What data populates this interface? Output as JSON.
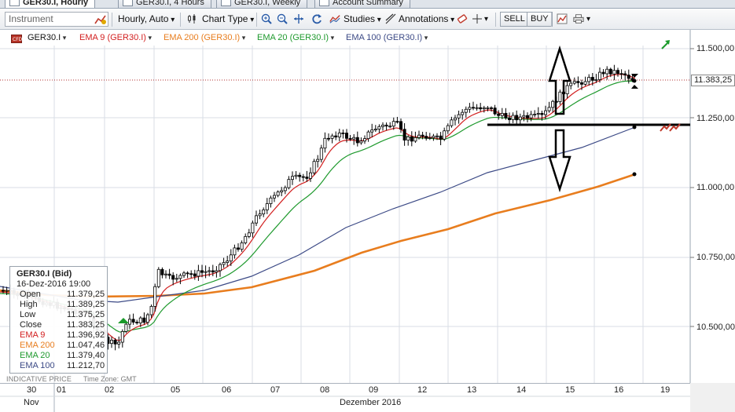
{
  "tabs": [
    {
      "label": "GER30.I, Hourly",
      "active": true
    },
    {
      "label": "GER30.I, 4 Hours",
      "active": false
    },
    {
      "label": "GER30.I, Weekly",
      "active": false
    },
    {
      "label": "Account Summary",
      "active": false
    }
  ],
  "toolbar": {
    "instrument_placeholder": "Instrument",
    "interval": "Hourly, Auto",
    "chart_type": "Chart Type",
    "studies": "Studies",
    "annotations": "Annotations",
    "sell": "SELL",
    "buy": "BUY"
  },
  "legend": {
    "symbol": "GER30.I",
    "ema9": "EMA 9 (GER30.I)",
    "ema200": "EMA 200 (GER30.I)",
    "ema20": "EMA 20 (GER30.I)",
    "ema100": "EMA 100 (GER30.I)"
  },
  "colors": {
    "ema9": "#d21f1f",
    "ema200": "#e87d1e",
    "ema20": "#1f9a2e",
    "ema100": "#3c4a86",
    "candle": "#000000",
    "grid": "#d9dee5",
    "price_line": "#b03030"
  },
  "y_axis": {
    "labels": [
      "11.500,00",
      "11.250,00",
      "11.000,00",
      "10.750,00",
      "10.500,00"
    ],
    "current_price": "11.383,25"
  },
  "info_box": {
    "title": "GER30.I (Bid)",
    "date": "16-Dez-2016 19:00",
    "rows": [
      {
        "key": "Open",
        "value": "11.379,25",
        "color": "#000000"
      },
      {
        "key": "High",
        "value": "11.389,25",
        "color": "#000000"
      },
      {
        "key": "Low",
        "value": "11.375,25",
        "color": "#000000"
      },
      {
        "key": "Close",
        "value": "11.383,25",
        "color": "#000000"
      },
      {
        "key": "EMA 9",
        "value": "11.396,92",
        "color": "#d21f1f"
      },
      {
        "key": "EMA 200",
        "value": "11.047,46",
        "color": "#e87d1e"
      },
      {
        "key": "EMA 20",
        "value": "11.379,40",
        "color": "#1f9a2e"
      },
      {
        "key": "EMA 100",
        "value": "11.212,70",
        "color": "#3c4a86"
      }
    ]
  },
  "footer": {
    "indicative": "INDICATIVE PRICE",
    "timezone": "Time Zone: GMT"
  },
  "x_axis": {
    "days": [
      "30",
      "01",
      "02",
      "05",
      "06",
      "07",
      "08",
      "09",
      "12",
      "13",
      "14",
      "15",
      "16",
      "19"
    ],
    "months": [
      "Nov",
      "Dezember 2016"
    ]
  },
  "icons": [
    "chart-settings-icon",
    "zoom-in-icon",
    "zoom-out-icon",
    "fit-icon",
    "refresh-icon",
    "eraser-icon",
    "crosshair-icon",
    "export-icon",
    "print-icon",
    "arrow-up-indicator-icon"
  ]
}
